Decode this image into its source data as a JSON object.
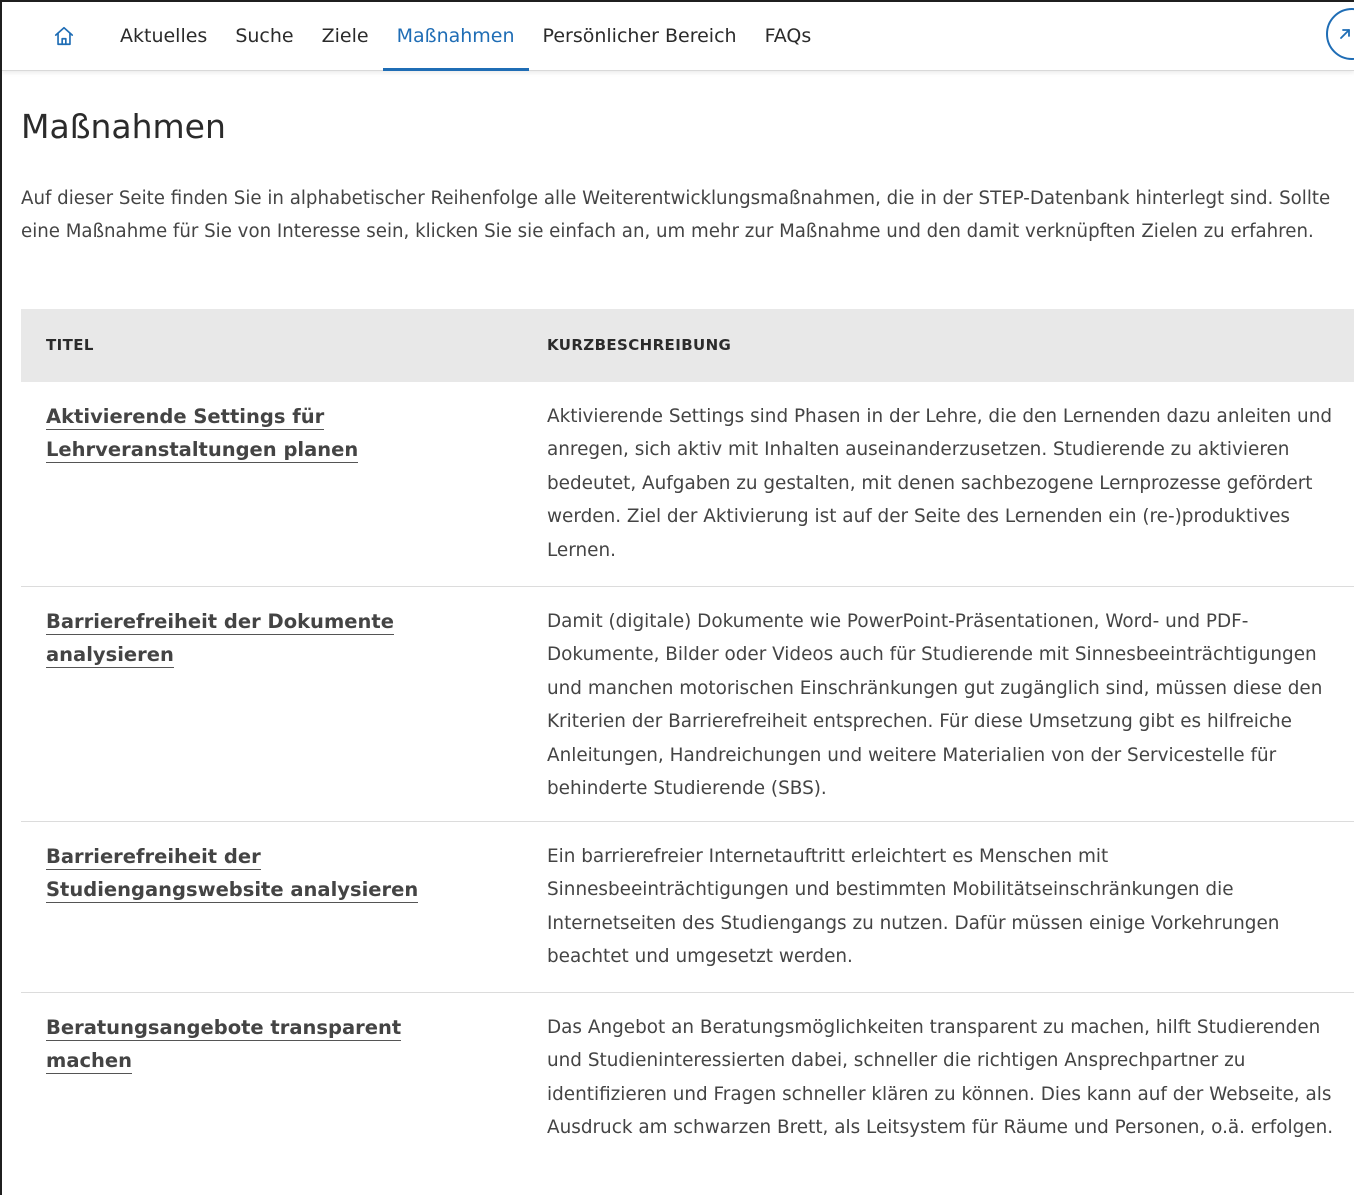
{
  "nav": {
    "items": [
      {
        "label": "Aktuelles"
      },
      {
        "label": "Suche"
      },
      {
        "label": "Ziele"
      },
      {
        "label": "Maßnahmen",
        "active": true
      },
      {
        "label": "Persönlicher Bereich"
      },
      {
        "label": "FAQs"
      }
    ],
    "accent_color": "#1f6db5"
  },
  "page": {
    "title": "Maßnahmen",
    "intro": "Auf dieser Seite finden Sie in alphabetischer Reihenfolge alle Weiterentwicklungsmaßnahmen, die in der STEP-Datenbank hinterlegt sind. Sollte eine Maßnahme für Sie von Interesse sein, klicken Sie sie einfach an, um mehr zur Maßnahme und den damit verknüpften Zielen zu erfahren."
  },
  "table": {
    "headers": {
      "title": "TITEL",
      "description": "KURZBESCHREIBUNG"
    },
    "rows": [
      {
        "title": "Aktivierende Settings für Lehrveranstaltungen planen",
        "description": "Aktivierende Settings sind Phasen in der Lehre, die den Lernenden dazu anleiten und anregen, sich aktiv mit Inhalten auseinanderzusetzen. Studierende zu aktivieren bedeutet, Aufgaben zu gestalten, mit denen sachbezogene Lernprozesse gefördert werden. Ziel der Aktivierung ist auf der Seite des Lernenden ein (re-)produktives Lernen."
      },
      {
        "title": "Barrierefreiheit der Dokumente analysieren",
        "description": "Damit (digitale) Dokumente wie PowerPoint-Präsentationen, Word- und PDF-Dokumente, Bilder oder Videos auch für Studierende mit Sinnesbeeinträchtigungen und manchen motorischen Einschränkungen gut zugänglich sind, müssen diese den Kriterien der Barrierefreiheit entsprechen. Für diese Umsetzung gibt es hilfreiche Anleitungen, Handreichungen und weitere Materialien von der Servicestelle für behinderte Studierende (SBS)."
      },
      {
        "title": "Barrierefreiheit der Studiengangswebsite analysieren",
        "description": "Ein barrierefreier Internetauftritt erleichtert es Menschen mit Sinnesbeeinträchtigungen und bestimmten Mobilitätseinschränkungen die Internetseiten des Studiengangs zu nutzen. Dafür müssen einige Vorkehrungen beachtet und umgesetzt werden."
      },
      {
        "title": "Beratungsangebote transparent machen",
        "description": "Das Angebot an Beratungsmöglichkeiten transparent zu machen, hilft Studierenden und Studieninteressierten dabei, schneller die richtigen Ansprechpartner zu identifizieren und Fragen schneller klären zu können. Dies kann auf der Webseite, als Ausdruck am schwarzen Brett, als Leitsystem für Räume und Personen, o.ä. erfolgen."
      }
    ]
  }
}
